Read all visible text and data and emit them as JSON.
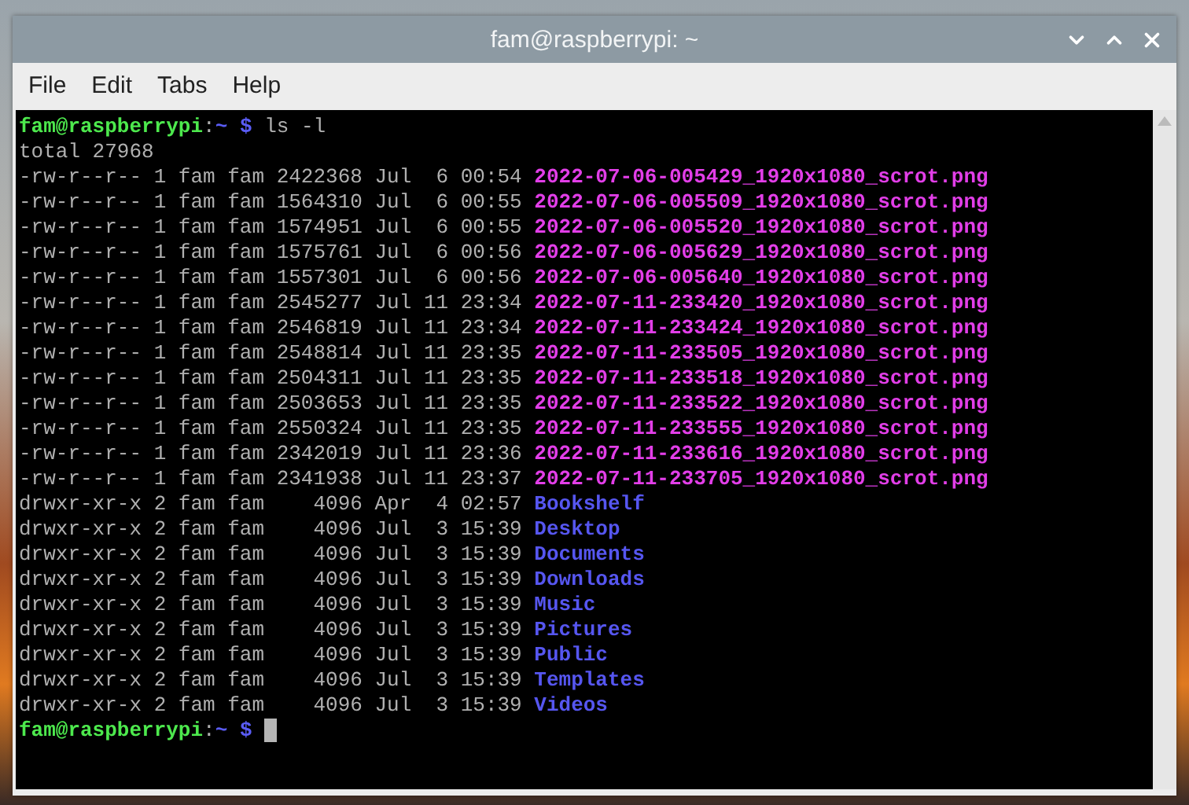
{
  "window": {
    "title": "fam@raspberrypi: ~"
  },
  "menu": [
    "File",
    "Edit",
    "Tabs",
    "Help"
  ],
  "terminal": {
    "command_prompt": {
      "user_host": "fam@raspberrypi",
      "separator": ":",
      "path": "~",
      "symbol": "$",
      "command": "ls -l"
    },
    "total": "total 27968",
    "entries": [
      {
        "kind": "file",
        "info": "-rw-r--r-- 1 fam fam 2422368 Jul  6 00:54",
        "name": "2022-07-06-005429_1920x1080_scrot.png"
      },
      {
        "kind": "file",
        "info": "-rw-r--r-- 1 fam fam 1564310 Jul  6 00:55",
        "name": "2022-07-06-005509_1920x1080_scrot.png"
      },
      {
        "kind": "file",
        "info": "-rw-r--r-- 1 fam fam 1574951 Jul  6 00:55",
        "name": "2022-07-06-005520_1920x1080_scrot.png"
      },
      {
        "kind": "file",
        "info": "-rw-r--r-- 1 fam fam 1575761 Jul  6 00:56",
        "name": "2022-07-06-005629_1920x1080_scrot.png"
      },
      {
        "kind": "file",
        "info": "-rw-r--r-- 1 fam fam 1557301 Jul  6 00:56",
        "name": "2022-07-06-005640_1920x1080_scrot.png"
      },
      {
        "kind": "file",
        "info": "-rw-r--r-- 1 fam fam 2545277 Jul 11 23:34",
        "name": "2022-07-11-233420_1920x1080_scrot.png"
      },
      {
        "kind": "file",
        "info": "-rw-r--r-- 1 fam fam 2546819 Jul 11 23:34",
        "name": "2022-07-11-233424_1920x1080_scrot.png"
      },
      {
        "kind": "file",
        "info": "-rw-r--r-- 1 fam fam 2548814 Jul 11 23:35",
        "name": "2022-07-11-233505_1920x1080_scrot.png"
      },
      {
        "kind": "file",
        "info": "-rw-r--r-- 1 fam fam 2504311 Jul 11 23:35",
        "name": "2022-07-11-233518_1920x1080_scrot.png"
      },
      {
        "kind": "file",
        "info": "-rw-r--r-- 1 fam fam 2503653 Jul 11 23:35",
        "name": "2022-07-11-233522_1920x1080_scrot.png"
      },
      {
        "kind": "file",
        "info": "-rw-r--r-- 1 fam fam 2550324 Jul 11 23:35",
        "name": "2022-07-11-233555_1920x1080_scrot.png"
      },
      {
        "kind": "file",
        "info": "-rw-r--r-- 1 fam fam 2342019 Jul 11 23:36",
        "name": "2022-07-11-233616_1920x1080_scrot.png"
      },
      {
        "kind": "file",
        "info": "-rw-r--r-- 1 fam fam 2341938 Jul 11 23:37",
        "name": "2022-07-11-233705_1920x1080_scrot.png"
      },
      {
        "kind": "dir",
        "info": "drwxr-xr-x 2 fam fam    4096 Apr  4 02:57",
        "name": "Bookshelf"
      },
      {
        "kind": "dir",
        "info": "drwxr-xr-x 2 fam fam    4096 Jul  3 15:39",
        "name": "Desktop"
      },
      {
        "kind": "dir",
        "info": "drwxr-xr-x 2 fam fam    4096 Jul  3 15:39",
        "name": "Documents"
      },
      {
        "kind": "dir",
        "info": "drwxr-xr-x 2 fam fam    4096 Jul  3 15:39",
        "name": "Downloads"
      },
      {
        "kind": "dir",
        "info": "drwxr-xr-x 2 fam fam    4096 Jul  3 15:39",
        "name": "Music"
      },
      {
        "kind": "dir",
        "info": "drwxr-xr-x 2 fam fam    4096 Jul  3 15:39",
        "name": "Pictures"
      },
      {
        "kind": "dir",
        "info": "drwxr-xr-x 2 fam fam    4096 Jul  3 15:39",
        "name": "Public"
      },
      {
        "kind": "dir",
        "info": "drwxr-xr-x 2 fam fam    4096 Jul  3 15:39",
        "name": "Templates"
      },
      {
        "kind": "dir",
        "info": "drwxr-xr-x 2 fam fam    4096 Jul  3 15:39",
        "name": "Videos"
      }
    ],
    "idle_prompt": {
      "user_host": "fam@raspberrypi",
      "separator": ":",
      "path": "~",
      "symbol": "$"
    }
  }
}
